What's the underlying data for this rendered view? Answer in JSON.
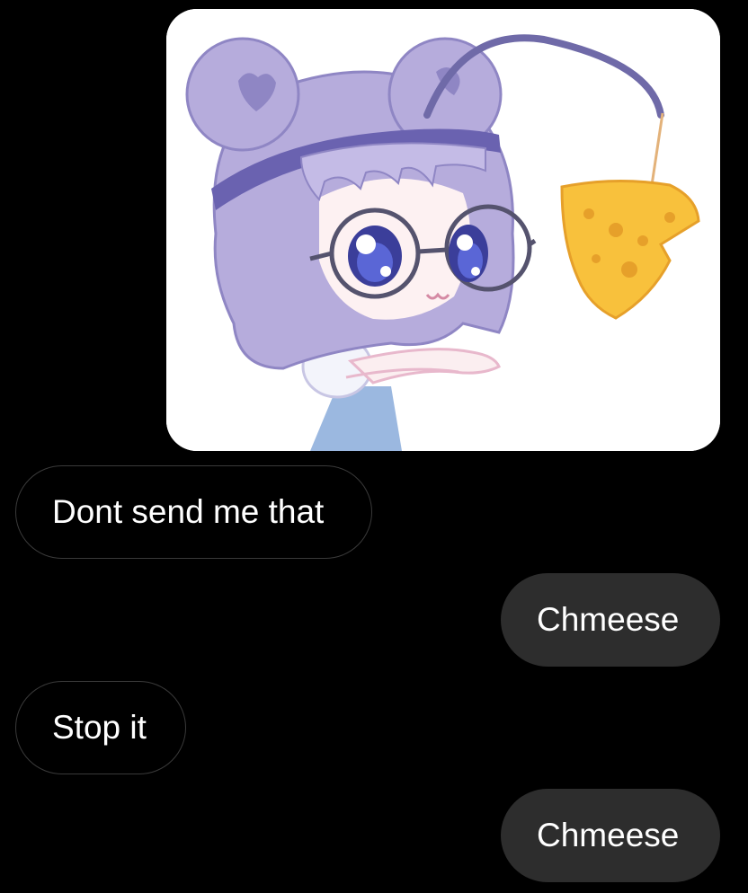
{
  "conversation": {
    "image_message": {
      "icon": "sticker-image",
      "colors": {
        "hair": "#b6acdc",
        "hair_dark": "#8f86c4",
        "headband": "#6a62b0",
        "cheese": "#f8c13c",
        "cheese_hole": "#e6a02a"
      }
    },
    "messages": [
      {
        "direction": "incoming",
        "text": "Dont send me that"
      },
      {
        "direction": "outgoing",
        "text": "Chmeese"
      },
      {
        "direction": "incoming",
        "text": "Stop it"
      },
      {
        "direction": "outgoing",
        "text": "Chmeese"
      }
    ]
  },
  "colors": {
    "background": "#000000",
    "outgoing_bubble": "#2d2d2d",
    "incoming_border": "#3a3a3a",
    "text": "#ffffff"
  }
}
